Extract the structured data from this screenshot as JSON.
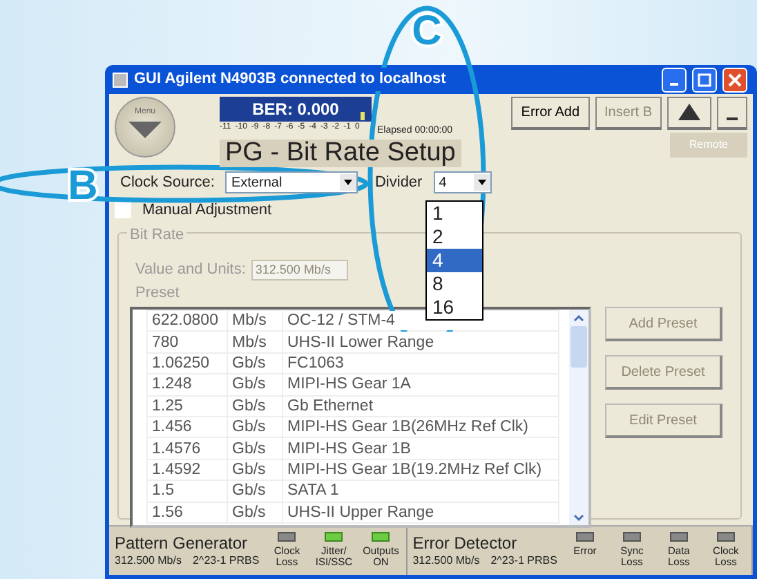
{
  "window": {
    "title": "GUI Agilent N4903B connected to localhost"
  },
  "menu_button": {
    "label": "Menu"
  },
  "ber": {
    "label": "BER: 0.000",
    "level": 0.93,
    "scale": [
      "-11",
      "-10",
      "-9",
      "-8",
      "-7",
      "-6",
      "-5",
      "-4",
      "-3",
      "-2",
      "-1",
      "0"
    ]
  },
  "elapsed": "Elapsed 00:00:00",
  "toolbar": [
    {
      "label": "Error Add",
      "disabled": false
    },
    {
      "label": "Insert B",
      "disabled": true
    }
  ],
  "remote": "Remote",
  "page_title": "PG - Bit Rate Setup",
  "clock_source": {
    "label": "Clock Source:",
    "value": "External"
  },
  "divider": {
    "label": "Divider",
    "value": "4",
    "expanded": true,
    "options": [
      {
        "label": "1",
        "selected": false
      },
      {
        "label": "2",
        "selected": false
      },
      {
        "label": "4",
        "selected": true
      },
      {
        "label": "8",
        "selected": false
      },
      {
        "label": "16",
        "selected": false
      }
    ]
  },
  "manual_adjustment": {
    "label": "Manual Adjustment",
    "checked": false
  },
  "bit_rate": {
    "title": "Bit Rate",
    "value_label": "Value and Units:",
    "value": "312.500 Mb/s",
    "preset_label": "Preset",
    "presets": [
      {
        "rate": "622.0800",
        "unit": "Mb/s",
        "standard": "OC-12 / STM-4"
      },
      {
        "rate": "780",
        "unit": "Mb/s",
        "standard": "UHS-II Lower Range"
      },
      {
        "rate": "1.06250",
        "unit": "Gb/s",
        "standard": "FC1063"
      },
      {
        "rate": "1.248",
        "unit": "Gb/s",
        "standard": "MIPI-HS Gear 1A"
      },
      {
        "rate": "1.25",
        "unit": "Gb/s",
        "standard": "Gb Ethernet"
      },
      {
        "rate": "1.456",
        "unit": "Gb/s",
        "standard": "MIPI-HS Gear 1B(26MHz Ref Clk)"
      },
      {
        "rate": "1.4576",
        "unit": "Gb/s",
        "standard": "MIPI-HS Gear 1B"
      },
      {
        "rate": "1.4592",
        "unit": "Gb/s",
        "standard": "MIPI-HS Gear 1B(19.2MHz Ref Clk)"
      },
      {
        "rate": "1.5",
        "unit": "Gb/s",
        "standard": "SATA 1"
      },
      {
        "rate": "1.56",
        "unit": "Gb/s",
        "standard": "UHS-II Upper Range"
      }
    ],
    "buttons": [
      {
        "label": "Add Preset",
        "disabled": true
      },
      {
        "label": "Delete Preset",
        "disabled": true
      },
      {
        "label": "Edit Preset",
        "disabled": true
      }
    ]
  },
  "status": [
    {
      "title": "Pattern Generator",
      "rate": "312.500 Mb/s",
      "pattern": "2^23-1 PRBS",
      "indicators": [
        {
          "label": "Clock Loss",
          "on": false
        },
        {
          "label": "Jitter/ ISI/SSC",
          "on": true
        },
        {
          "label": "Outputs ON",
          "on": true
        }
      ]
    },
    {
      "title": "Error Detector",
      "rate": "312.500 Mb/s",
      "pattern": "2^23-1 PRBS",
      "indicators": [
        {
          "label": "Error",
          "on": false
        },
        {
          "label": "Sync Loss",
          "on": false
        },
        {
          "label": "Data Loss",
          "on": false
        },
        {
          "label": "Clock Loss",
          "on": false
        }
      ]
    }
  ],
  "annotations": [
    {
      "label": "B"
    },
    {
      "label": "C"
    }
  ]
}
